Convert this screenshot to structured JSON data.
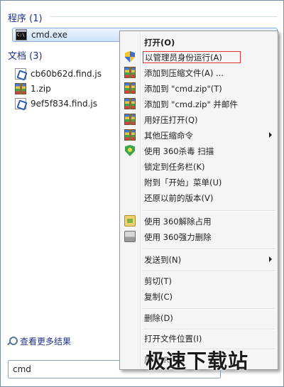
{
  "results": {
    "programs_header": "程序 (1)",
    "documents_header": "文档 (3)",
    "programs": [
      {
        "name": "cmd.exe",
        "icon": "cmd-icon"
      }
    ],
    "documents": [
      {
        "name": "cb60b62d.find.js",
        "icon": "js-icon"
      },
      {
        "name": "1.zip",
        "icon": "zip-icon"
      },
      {
        "name": "9ef5f834.find.js",
        "icon": "js-icon"
      }
    ],
    "see_more": "查看更多结果"
  },
  "search": {
    "value": "cmd"
  },
  "context_menu": {
    "items": [
      {
        "label": "打开(O)"
      },
      {
        "label": "以管理员身份运行(A)",
        "icon": "shield-icon"
      },
      {
        "label": "添加到压缩文件(A) ...",
        "icon": "zip-icon"
      },
      {
        "label": "添加到 \"cmd.zip\"(T)",
        "icon": "zip-icon"
      },
      {
        "label": "添加到 \"cmd.zip\" 并邮件",
        "icon": "zip-icon"
      },
      {
        "label": "用好压打开(Q)",
        "icon": "zip-icon"
      },
      {
        "label": "其他压缩命令",
        "icon": "zip-icon",
        "submenu": true
      },
      {
        "label": "使用 360杀毒 扫描",
        "icon": "guard-icon"
      },
      {
        "label": "锁定到任务栏(K)"
      },
      {
        "label": "附到「开始」菜单(U)"
      },
      {
        "label": "还原以前的版本(V)"
      },
      {
        "label": "使用 360解除占用",
        "icon": "unlock-icon"
      },
      {
        "label": "使用 360强力删除",
        "icon": "shredder-icon"
      },
      {
        "label": "发送到(N)",
        "submenu": true
      },
      {
        "label": "剪切(T)"
      },
      {
        "label": "复制(C)"
      },
      {
        "label": "删除(D)"
      },
      {
        "label": "打开文件位置(I)"
      },
      {
        "label": "属性(R)"
      }
    ]
  },
  "watermark": "极速下载站",
  "colors": {
    "header_text": "#1e3287",
    "focus_outline": "#e23434",
    "menu_background": "#f5f5f5"
  }
}
